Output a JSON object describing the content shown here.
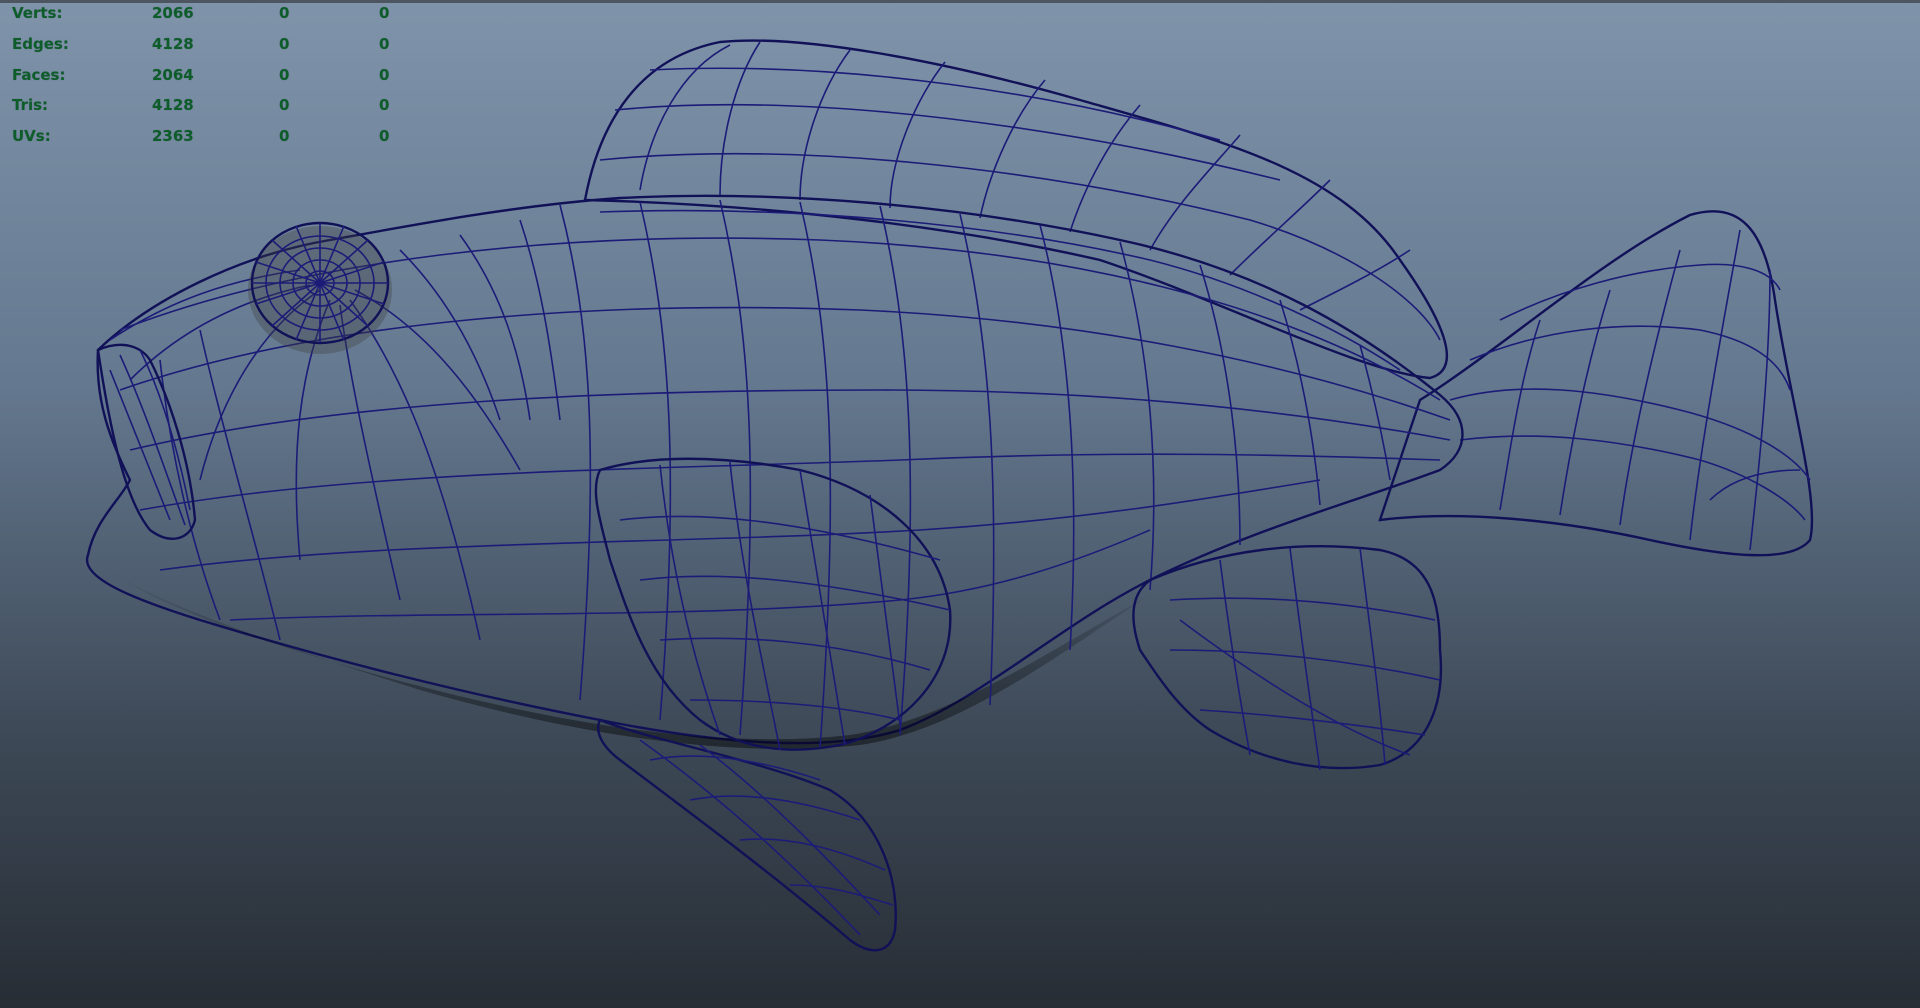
{
  "heads_up_display": {
    "poly_count": [
      {
        "label": "Verts:",
        "values": [
          "2066",
          "0",
          "0"
        ]
      },
      {
        "label": "Edges:",
        "values": [
          "4128",
          "0",
          "0"
        ]
      },
      {
        "label": "Faces:",
        "values": [
          "2064",
          "0",
          "0"
        ]
      },
      {
        "label": "Tris:",
        "values": [
          "4128",
          "0",
          "0"
        ]
      },
      {
        "label": "UVs:",
        "values": [
          "2363",
          "0",
          "0"
        ]
      }
    ]
  },
  "viewport": {
    "background_top": "#7f93aa",
    "background_bottom": "#272d35",
    "mesh_fill": "#808080",
    "wireframe_color": "#1c1c78",
    "hud_text_color": "#0d5d2a"
  }
}
